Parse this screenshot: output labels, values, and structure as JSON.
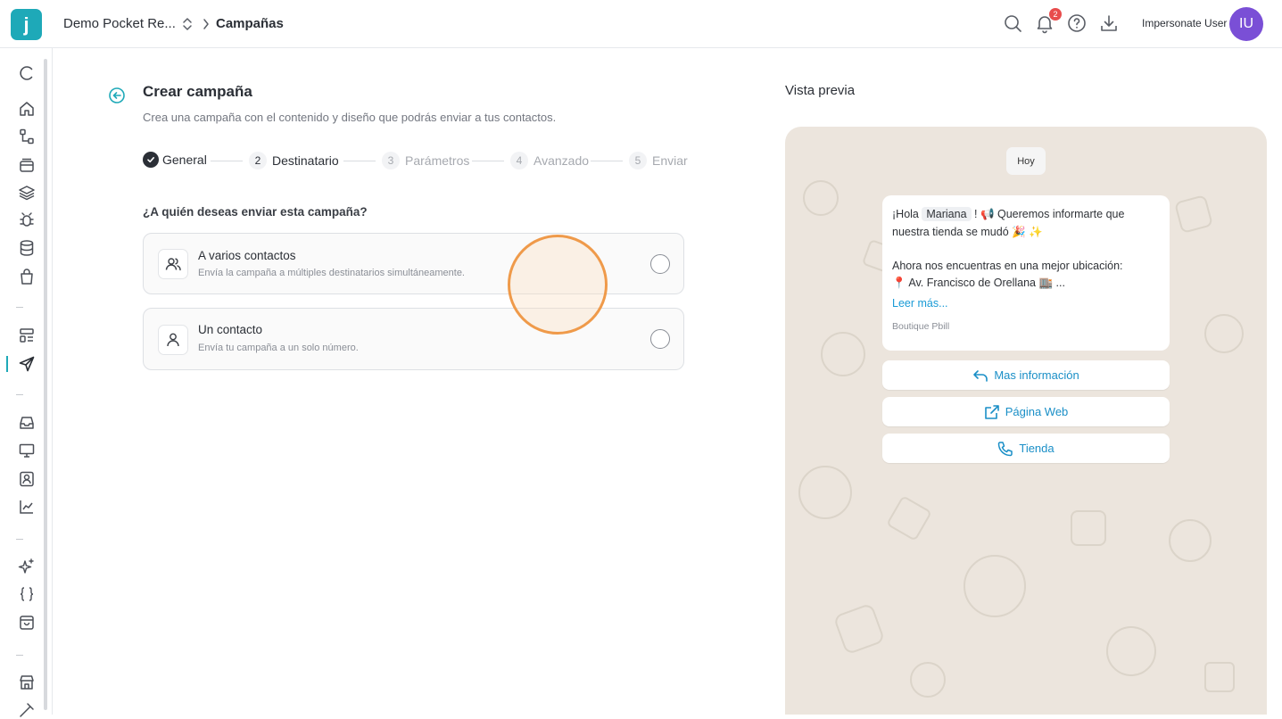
{
  "header": {
    "logo_letter": "j",
    "project_name": "Demo Pocket Re...",
    "current_page": "Campañas",
    "notification_count": "2",
    "user_name": "Impersonate User",
    "user_initials": "IU"
  },
  "sidebar": {
    "items": [
      {
        "icon": "loading-icon"
      },
      {
        "icon": "home-icon"
      },
      {
        "icon": "flow-icon"
      },
      {
        "icon": "archive-icon"
      },
      {
        "icon": "layers-icon"
      },
      {
        "icon": "bug-icon"
      },
      {
        "icon": "database-icon"
      },
      {
        "icon": "shopping-bag-icon"
      },
      {
        "icon": "templates-icon"
      },
      {
        "icon": "send-icon",
        "active": true
      },
      {
        "icon": "inbox-icon"
      },
      {
        "icon": "monitor-icon"
      },
      {
        "icon": "contacts-icon"
      },
      {
        "icon": "chart-icon"
      },
      {
        "icon": "sparkles-icon"
      },
      {
        "icon": "code-braces-icon"
      },
      {
        "icon": "store-bag-icon"
      },
      {
        "icon": "store-icon"
      },
      {
        "icon": "integrations-icon"
      }
    ]
  },
  "form": {
    "title": "Crear campaña",
    "subtitle": "Crea una campaña con el contenido y diseño que podrás enviar a tus contactos.",
    "steps": [
      {
        "number": "",
        "label": "General",
        "state": "done"
      },
      {
        "number": "2",
        "label": "Destinatario",
        "state": "active"
      },
      {
        "number": "3",
        "label": "Parámetros",
        "state": "pending"
      },
      {
        "number": "4",
        "label": "Avanzado",
        "state": "pending"
      },
      {
        "number": "5",
        "label": "Enviar",
        "state": "pending"
      }
    ],
    "question": "¿A quién deseas enviar esta campaña?",
    "options": [
      {
        "title": "A varios contactos",
        "description": "Envía la campaña a múltiples destinatarios simultáneamente.",
        "icon": "users-icon"
      },
      {
        "title": "Un contacto",
        "description": "Envía tu campaña a un solo número.",
        "icon": "user-icon"
      }
    ]
  },
  "preview": {
    "title": "Vista previa",
    "day_label": "Hoy",
    "greeting_pre": "¡Hola",
    "variable": "Mariana",
    "greeting_post": "! 📢 Queremos informarte que",
    "line2": "nuestra tienda se mudó 🎉 ✨",
    "line3": "Ahora nos encuentras en una mejor ubicación:",
    "line4": "📍 Av. Francisco de Orellana 🏬 ...",
    "read_more": "Leer más...",
    "footer": "Boutique Pbill",
    "buttons": [
      {
        "label": "Mas información",
        "icon": "reply-icon"
      },
      {
        "label": "Página Web",
        "icon": "external-link-icon"
      },
      {
        "label": "Tienda",
        "icon": "phone-icon"
      }
    ]
  },
  "colors": {
    "brand": "#1ea9b8",
    "avatar": "#7a4fd6",
    "badge": "#e84c4c",
    "preview_bg": "#ece5dd",
    "link": "#1a9bd6",
    "click_ring": "#ef9a4a"
  }
}
